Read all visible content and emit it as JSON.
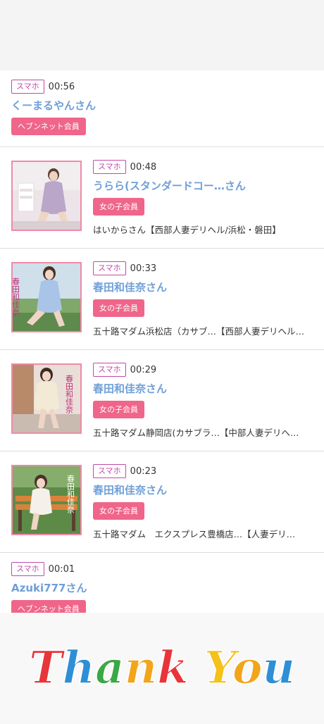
{
  "entries": [
    {
      "tag": "スマホ",
      "time": "00:56",
      "name": "くーまるやんさん",
      "badge": "ヘブンネット会員"
    },
    {
      "tag": "スマホ",
      "time": "00:48",
      "name": "うらら(スタンダードコー…さん",
      "badge": "女の子会員",
      "shop": "はいからさん【西部人妻デリヘル/浜松・磐田】",
      "thumb": "woman-photo-1"
    },
    {
      "tag": "スマホ",
      "time": "00:33",
      "name": "春田和佳奈さん",
      "badge": "女の子会員",
      "shop": "五十路マダム浜松店（カサブ…【西部人妻デリヘル…",
      "thumb": "woman-photo-2",
      "thumb_caption": "春田和佳奈"
    },
    {
      "tag": "スマホ",
      "time": "00:29",
      "name": "春田和佳奈さん",
      "badge": "女の子会員",
      "shop": "五十路マダム静岡店(カサブラ…【中部人妻デリへ…",
      "thumb": "woman-photo-3",
      "thumb_caption": "春田和佳奈"
    },
    {
      "tag": "スマホ",
      "time": "00:23",
      "name": "春田和佳奈さん",
      "badge": "女の子会員",
      "shop": "五十路マダム　エクスプレス豊橋店…【人妻デリ…",
      "thumb": "woman-photo-4",
      "thumb_caption": "春田和佳奈"
    },
    {
      "tag": "スマホ",
      "time": "00:01",
      "name": "Azuki777さん",
      "badge": "ヘブンネット会員"
    }
  ],
  "footer": {
    "text": "Thank You"
  },
  "colors": {
    "tag": "#c04aaa",
    "name": "#6f9fd8",
    "badge": "#f0658a",
    "thumb_border": "#f08aa8"
  }
}
